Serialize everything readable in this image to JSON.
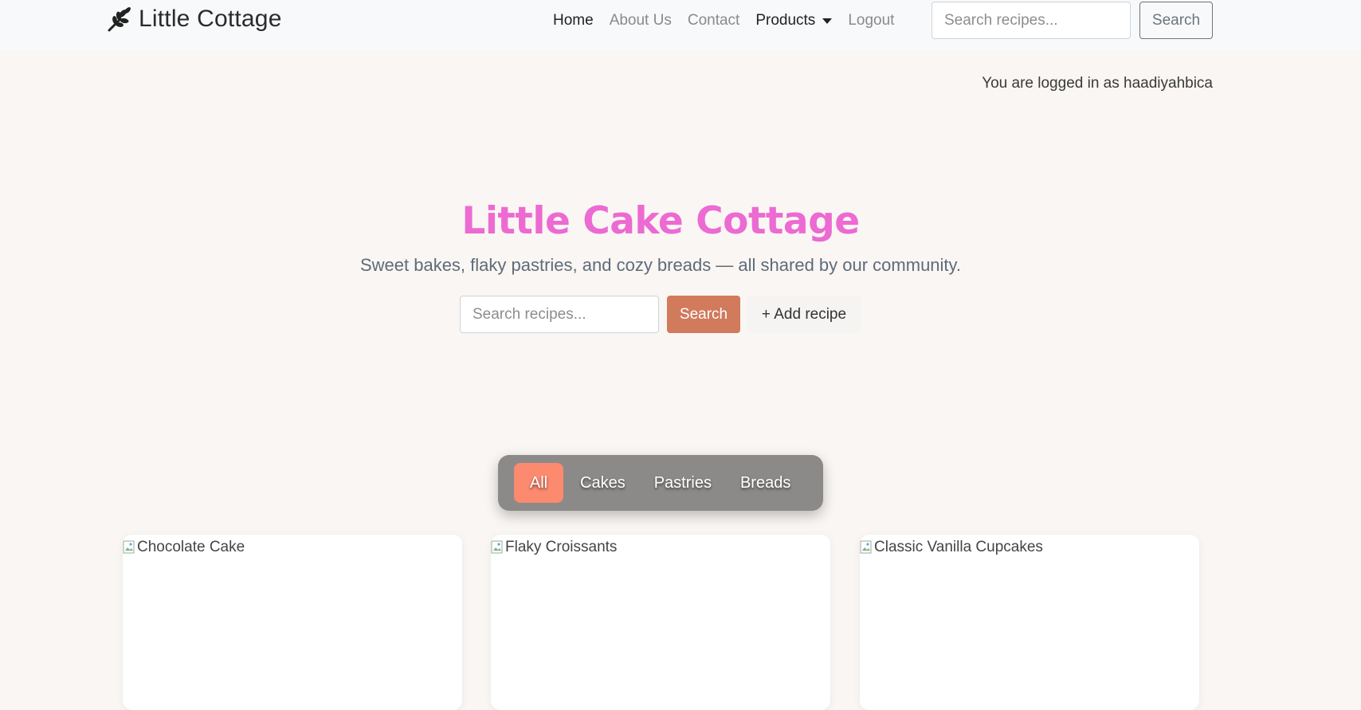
{
  "navbar": {
    "brand": "Little Cottage",
    "brand_icon": "wheat-icon",
    "links": [
      {
        "label": "Home"
      },
      {
        "label": "About Us"
      },
      {
        "label": "Contact"
      },
      {
        "label": "Products"
      },
      {
        "label": "Logout"
      }
    ],
    "search_placeholder": "Search recipes...",
    "search_button": "Search"
  },
  "login_status": "You are logged in as haadiyahbica",
  "hero": {
    "title": "Little Cake Cottage",
    "subtitle": "Sweet bakes, flaky pastries, and cozy breads — all shared by our community.",
    "search_placeholder": "Search recipes...",
    "search_button": "Search",
    "add_button": "+ Add recipe",
    "title_color": "#ec6ad2",
    "accent_color": "#d17a5c"
  },
  "filters": {
    "active_color": "#fb8a6f",
    "items": [
      {
        "label": "All"
      },
      {
        "label": "Cakes"
      },
      {
        "label": "Pastries"
      },
      {
        "label": "Breads"
      }
    ]
  },
  "recipes": [
    {
      "image_alt": "Chocolate Cake"
    },
    {
      "image_alt": "Flaky Croissants"
    },
    {
      "image_alt": "Classic Vanilla Cupcakes"
    }
  ]
}
